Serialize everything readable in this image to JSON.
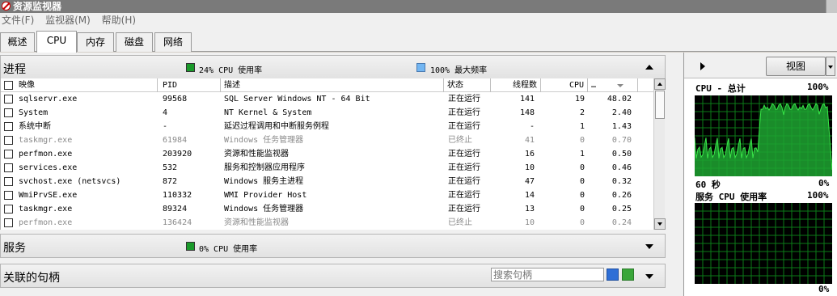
{
  "window": {
    "title": "资源监视器"
  },
  "menu": [
    "文件(F)",
    "监视器(M)",
    "帮助(H)"
  ],
  "tabs": [
    {
      "label": "概述",
      "active": false
    },
    {
      "label": "CPU",
      "active": true
    },
    {
      "label": "内存",
      "active": false
    },
    {
      "label": "磁盘",
      "active": false
    },
    {
      "label": "网络",
      "active": false
    }
  ],
  "processes": {
    "title": "进程",
    "cpu_usage_text": "24% CPU 使用率",
    "max_freq_text": "100% 最大频率",
    "columns": [
      "映像",
      "PID",
      "描述",
      "状态",
      "线程数",
      "CPU",
      "…"
    ],
    "rows": [
      {
        "image": "sqlservr.exe",
        "pid": "99568",
        "desc": "SQL Server Windows NT - 64 Bit",
        "status": "正在运行",
        "threads": "141",
        "cpu": "19",
        "avg": "48.02",
        "ended": false
      },
      {
        "image": "System",
        "pid": "4",
        "desc": "NT Kernel & System",
        "status": "正在运行",
        "threads": "148",
        "cpu": "2",
        "avg": "2.40",
        "ended": false
      },
      {
        "image": "系统中断",
        "pid": "-",
        "desc": "延迟过程调用和中断服务例程",
        "status": "正在运行",
        "threads": "-",
        "cpu": "1",
        "avg": "1.43",
        "ended": false
      },
      {
        "image": "taskmgr.exe",
        "pid": "61984",
        "desc": "Windows 任务管理器",
        "status": "已终止",
        "threads": "41",
        "cpu": "0",
        "avg": "0.70",
        "ended": true
      },
      {
        "image": "perfmon.exe",
        "pid": "203920",
        "desc": "资源和性能监视器",
        "status": "正在运行",
        "threads": "16",
        "cpu": "1",
        "avg": "0.50",
        "ended": false
      },
      {
        "image": "services.exe",
        "pid": "532",
        "desc": "服务和控制器应用程序",
        "status": "正在运行",
        "threads": "10",
        "cpu": "0",
        "avg": "0.46",
        "ended": false
      },
      {
        "image": "svchost.exe (netsvcs)",
        "pid": "872",
        "desc": "Windows 服务主进程",
        "status": "正在运行",
        "threads": "47",
        "cpu": "0",
        "avg": "0.32",
        "ended": false
      },
      {
        "image": "WmiPrvSE.exe",
        "pid": "110332",
        "desc": "WMI Provider Host",
        "status": "正在运行",
        "threads": "14",
        "cpu": "0",
        "avg": "0.26",
        "ended": false
      },
      {
        "image": "taskmgr.exe",
        "pid": "89324",
        "desc": "Windows 任务管理器",
        "status": "正在运行",
        "threads": "13",
        "cpu": "0",
        "avg": "0.25",
        "ended": false
      },
      {
        "image": "perfmon.exe",
        "pid": "136424",
        "desc": "资源和性能监视器",
        "status": "已终止",
        "threads": "10",
        "cpu": "0",
        "avg": "0.24",
        "ended": true
      }
    ]
  },
  "services": {
    "title": "服务",
    "cpu_usage_text": "0% CPU 使用率"
  },
  "handles": {
    "title": "关联的句柄",
    "search_placeholder": "搜索句柄"
  },
  "right_panel": {
    "view_button": "视图",
    "graph1": {
      "title": "CPU - 总计",
      "max": "100%",
      "time": "60 秒",
      "min": "0%"
    },
    "graph2": {
      "title": "服务 CPU 使用率",
      "max": "100%",
      "min": "0%"
    }
  },
  "colors": {
    "cpu_green": "#1a9a2a",
    "freq_blue": "#73b6f2",
    "graph_grid": "#0b7a18",
    "graph_line": "#39e649",
    "graph_fill": "#1fa531"
  }
}
